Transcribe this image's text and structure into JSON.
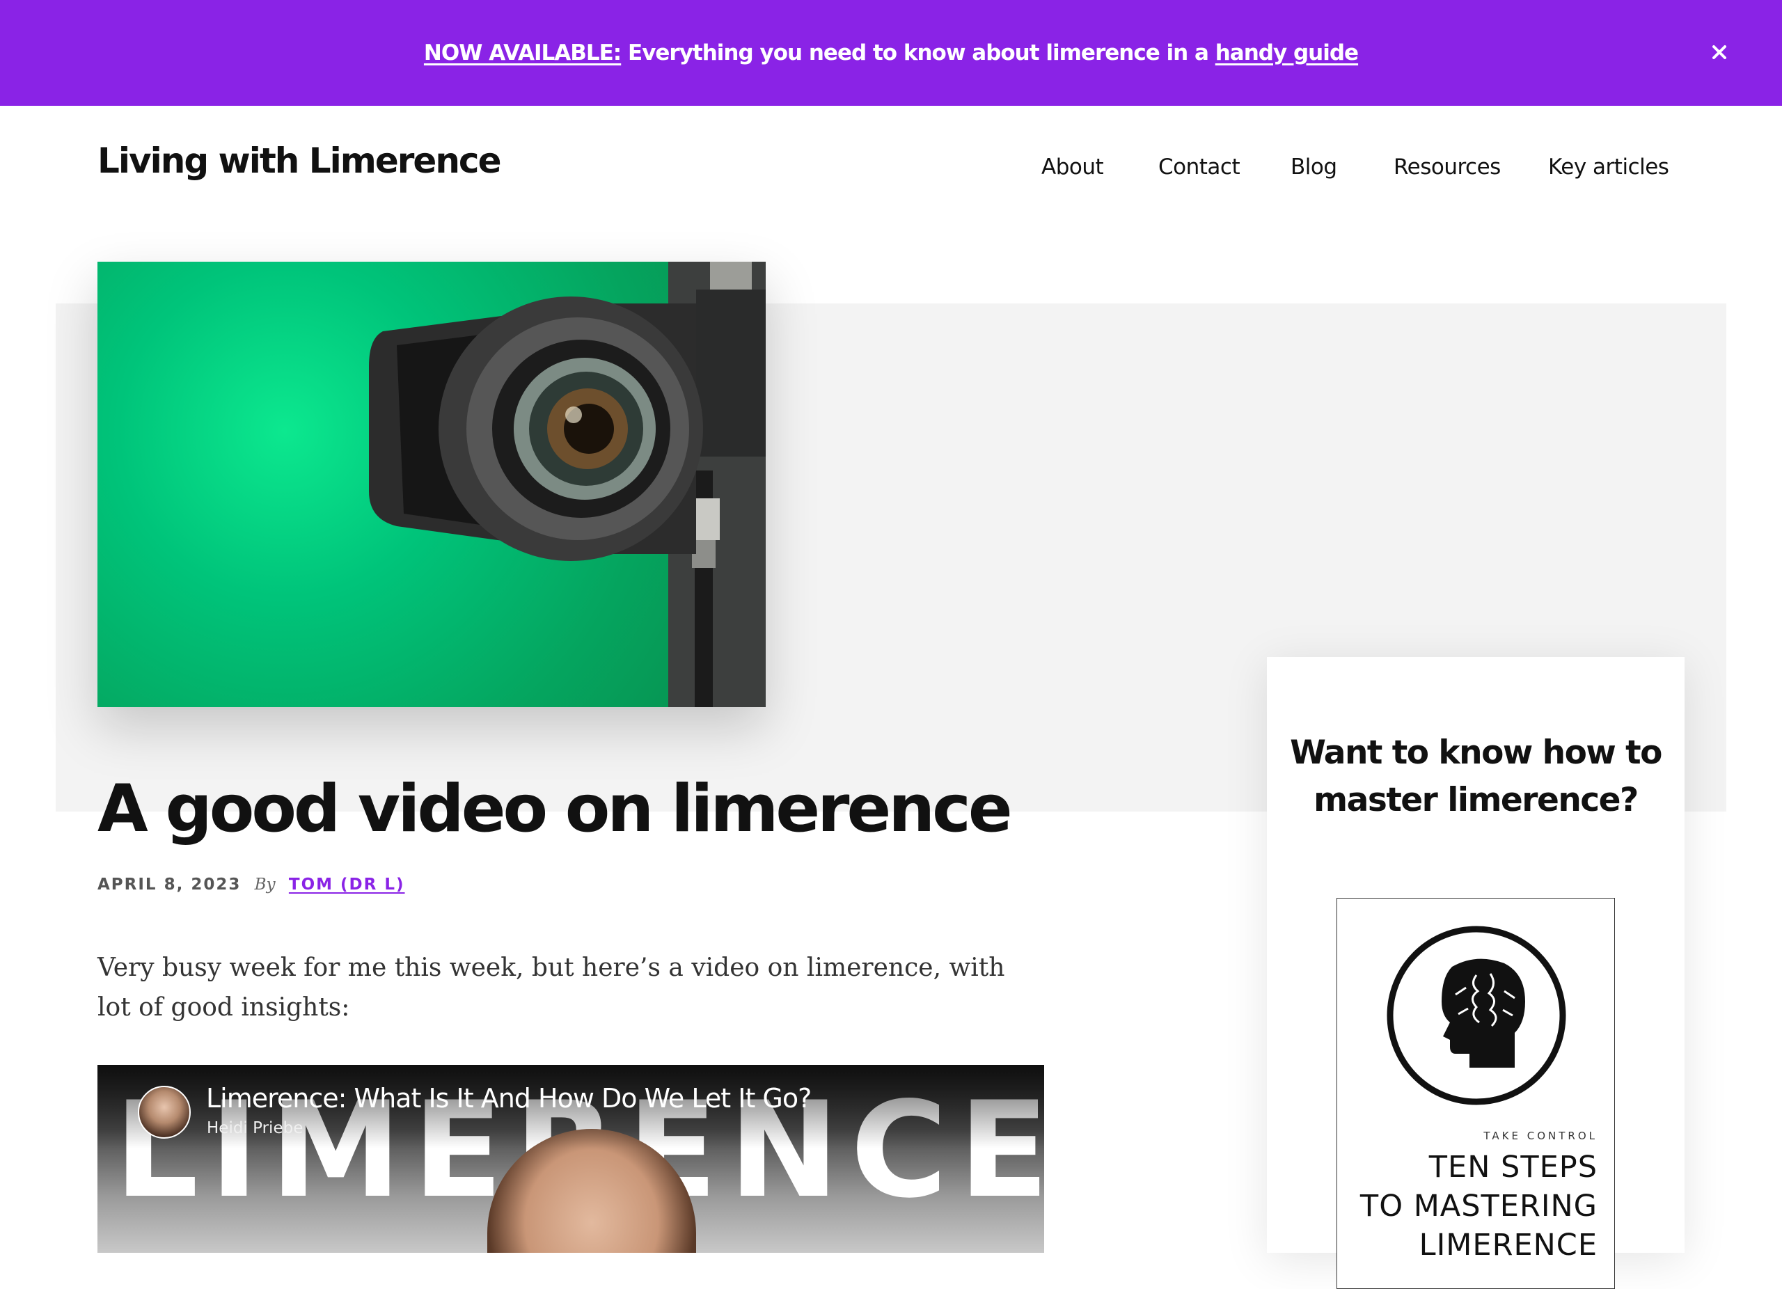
{
  "announcement": {
    "prefix_link": "NOW AVAILABLE:",
    "message": " Everything you need to know about limerence in a ",
    "guide_link": "handy guide",
    "close_icon": "×"
  },
  "header": {
    "site_title": "Living with Limerence",
    "nav": [
      "About",
      "Contact",
      "Blog",
      "Resources",
      "Key articles"
    ]
  },
  "hero": {
    "image_icon": "video-camera-photo"
  },
  "post": {
    "title": "A good video on limerence",
    "date": "APRIL 8, 2023",
    "by": "By",
    "author": "TOM (DR L)",
    "intro": "Very busy week for me this week, but here’s a video on limerence, with lot of good insights:"
  },
  "video": {
    "title": "Limerence: What Is It And How Do We Let It Go?",
    "channel": "Heidi Priebe",
    "thumbnail_word": "LIMERENCE"
  },
  "sidebar": {
    "heading": "Want to know how to master limerence?",
    "book": {
      "kicker": "TAKE CONTROL",
      "title_lines": [
        "TEN STEPS",
        "TO MASTERING",
        "LIMERENCE"
      ]
    }
  },
  "colors": {
    "accent": "#8a23e6",
    "hero_band": "#f3f3f3",
    "text": "#111111"
  }
}
